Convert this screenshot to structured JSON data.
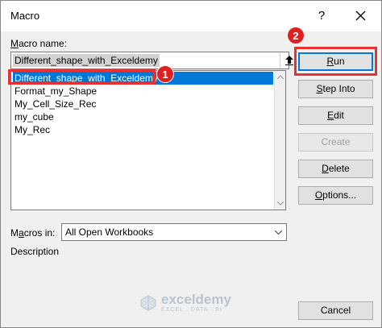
{
  "window": {
    "title": "Macro",
    "help_label": "?"
  },
  "form": {
    "macro_name_label_pre": "",
    "macro_name_label_mn": "M",
    "macro_name_label_post": "acro name:",
    "macro_name_value": "Different_shape_with_Exceldemy",
    "macros_in_label_pre": "M",
    "macros_in_label_mn": "a",
    "macros_in_label_post": "cros in:",
    "macros_in_value": "All Open Workbooks",
    "description_label": "Description"
  },
  "macros": [
    "Different_shape_with_Exceldemy",
    "Format_my_Shape",
    "My_Cell_Size_Rec",
    "my_cube",
    "My_Rec"
  ],
  "buttons": {
    "run_mn": "R",
    "run_rest": "un",
    "step_into_mn": "S",
    "step_into_rest": "tep Into",
    "edit_mn": "E",
    "edit_rest": "dit",
    "create": "Create",
    "delete_mn": "D",
    "delete_rest": "elete",
    "options_mn": "O",
    "options_rest": "ptions...",
    "cancel": "Cancel"
  },
  "annotations": {
    "badge_1": "1",
    "badge_2": "2",
    "highlight_color": "#e63232"
  },
  "watermark": {
    "main": "exceldemy",
    "sub": "EXCEL · DATA · BI"
  },
  "colors": {
    "selection": "#0078d7",
    "dialog_bg": "#f0f0f0"
  }
}
